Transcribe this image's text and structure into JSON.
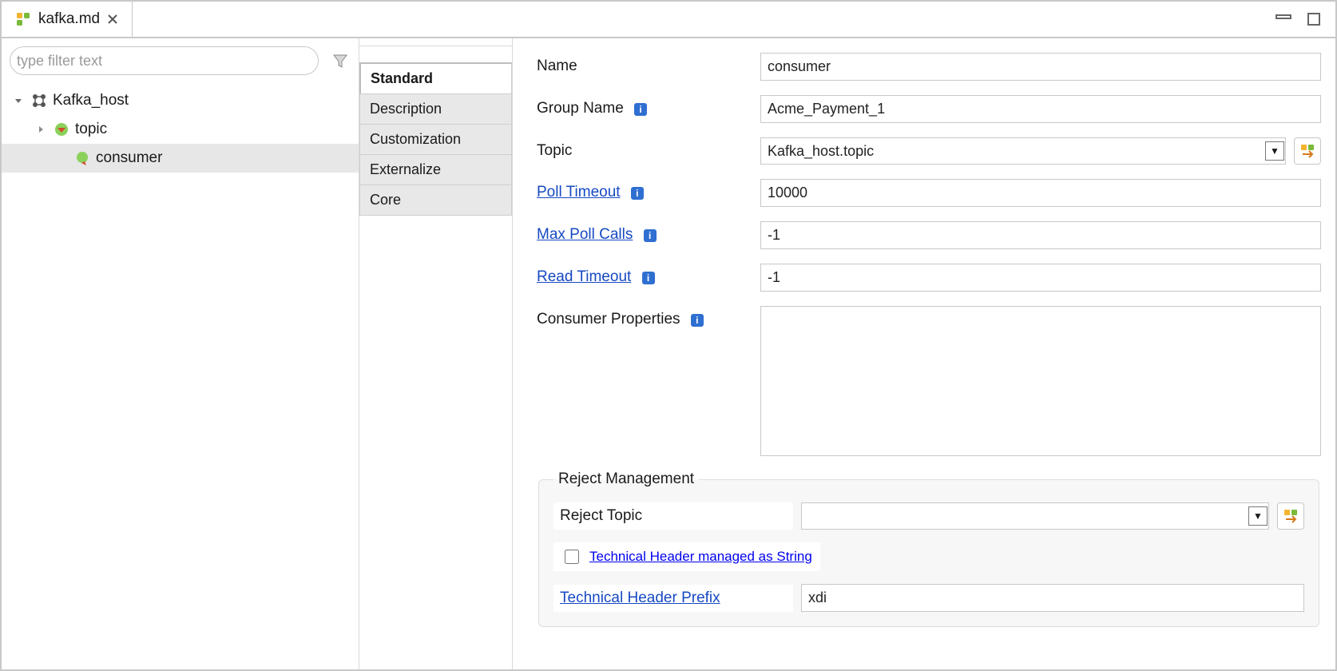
{
  "editor": {
    "tab_label": "kafka.md"
  },
  "sidebar": {
    "filter_placeholder": "type filter text",
    "nodes": {
      "root": "Kafka_host",
      "topic": "topic",
      "consumer": "consumer"
    }
  },
  "vtabs": {
    "standard": "Standard",
    "description": "Description",
    "customization": "Customization",
    "externalize": "Externalize",
    "core": "Core"
  },
  "form": {
    "labels": {
      "name": "Name",
      "group_name": "Group Name",
      "topic": "Topic",
      "poll_timeout": "Poll Timeout",
      "max_poll_calls": "Max Poll Calls",
      "read_timeout": "Read Timeout",
      "consumer_properties": "Consumer Properties"
    },
    "values": {
      "name": "consumer",
      "group_name": "Acme_Payment_1",
      "topic_selected": "Kafka_host.topic",
      "poll_timeout": "10000",
      "max_poll_calls": "-1",
      "read_timeout": "-1",
      "consumer_properties": ""
    },
    "topic_options": [
      "Kafka_host.topic"
    ]
  },
  "reject": {
    "legend": "Reject Management",
    "labels": {
      "reject_topic": "Reject Topic",
      "tech_header_string": "Technical Header managed as String",
      "tech_header_prefix": "Technical Header Prefix"
    },
    "values": {
      "reject_topic_selected": "",
      "tech_header_string_checked": false,
      "tech_header_prefix": "xdi"
    }
  },
  "icons": {
    "info_glyph": "i"
  }
}
